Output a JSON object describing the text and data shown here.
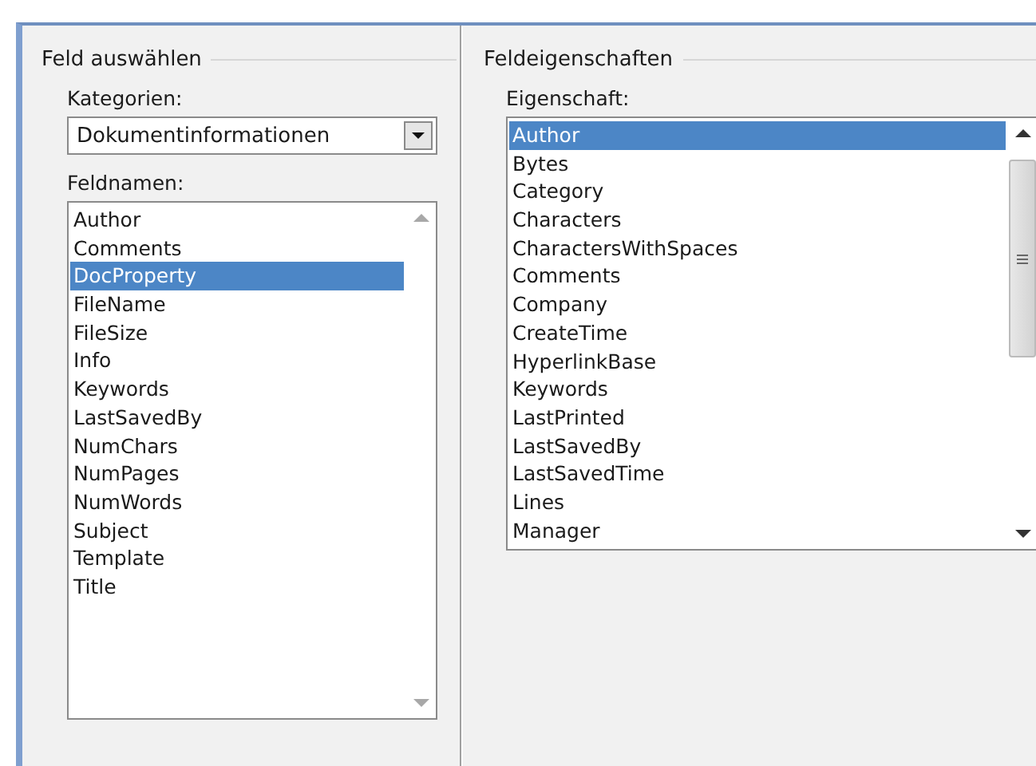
{
  "field_select": {
    "title": "Feld auswählen",
    "category_label": "Kategorien:",
    "category_value": "Dokumentinformationen",
    "names_label": "Feldnamen:",
    "field_names": [
      {
        "label": "Author",
        "selected": false
      },
      {
        "label": "Comments",
        "selected": false
      },
      {
        "label": "DocProperty",
        "selected": true
      },
      {
        "label": "FileName",
        "selected": false
      },
      {
        "label": "FileSize",
        "selected": false
      },
      {
        "label": "Info",
        "selected": false
      },
      {
        "label": "Keywords",
        "selected": false
      },
      {
        "label": "LastSavedBy",
        "selected": false
      },
      {
        "label": "NumChars",
        "selected": false
      },
      {
        "label": "NumPages",
        "selected": false
      },
      {
        "label": "NumWords",
        "selected": false
      },
      {
        "label": "Subject",
        "selected": false
      },
      {
        "label": "Template",
        "selected": false
      },
      {
        "label": "Title",
        "selected": false
      }
    ]
  },
  "field_properties": {
    "title": "Feldeigenschaften",
    "property_label": "Eigenschaft:",
    "properties": [
      {
        "label": "Author",
        "selected": true
      },
      {
        "label": "Bytes",
        "selected": false
      },
      {
        "label": "Category",
        "selected": false
      },
      {
        "label": "Characters",
        "selected": false
      },
      {
        "label": "CharactersWithSpaces",
        "selected": false
      },
      {
        "label": "Comments",
        "selected": false
      },
      {
        "label": "Company",
        "selected": false
      },
      {
        "label": "CreateTime",
        "selected": false
      },
      {
        "label": "HyperlinkBase",
        "selected": false
      },
      {
        "label": "Keywords",
        "selected": false
      },
      {
        "label": "LastPrinted",
        "selected": false
      },
      {
        "label": "LastSavedBy",
        "selected": false
      },
      {
        "label": "LastSavedTime",
        "selected": false
      },
      {
        "label": "Lines",
        "selected": false
      },
      {
        "label": "Manager",
        "selected": false
      }
    ]
  }
}
